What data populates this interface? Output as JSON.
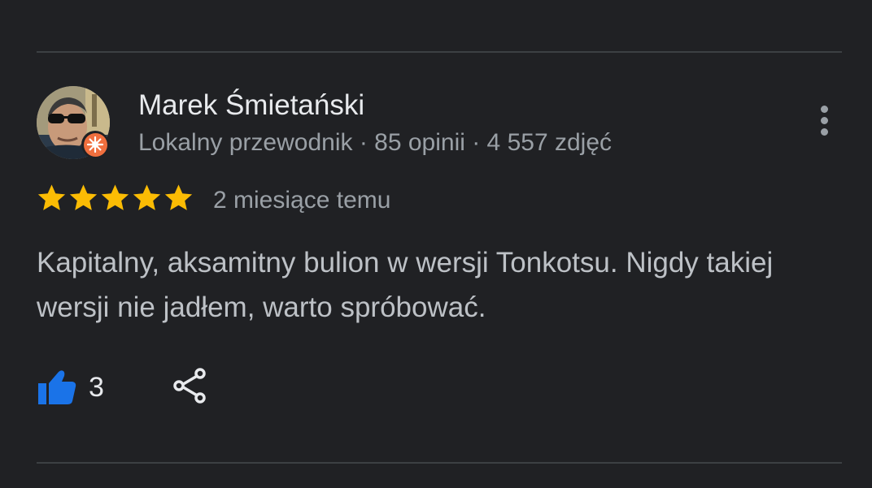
{
  "review": {
    "author": {
      "name": "Marek Śmietański",
      "meta": "Lokalny przewodnik · 85 opinii · 4 557 zdjęć",
      "avatar_icon": "user-avatar-photo",
      "badge_icon": "local-guide-badge-icon"
    },
    "rating": 5,
    "rating_max": 5,
    "date": "2 miesiące temu",
    "text": "Kapitalny, aksamitny bulion w wersji Tonkotsu. Nigdy takiej wersji nie jadłem, warto spróbować.",
    "likes": "3",
    "like_icon": "thumbs-up-icon",
    "share_icon": "share-icon",
    "menu_icon": "more-vert-icon"
  },
  "colors": {
    "background": "#202124",
    "star": "#fbbc04",
    "like": "#1a73e8",
    "badge": "#f06f3e",
    "primary_text": "#e8eaed",
    "secondary_text": "#9aa0a6"
  }
}
